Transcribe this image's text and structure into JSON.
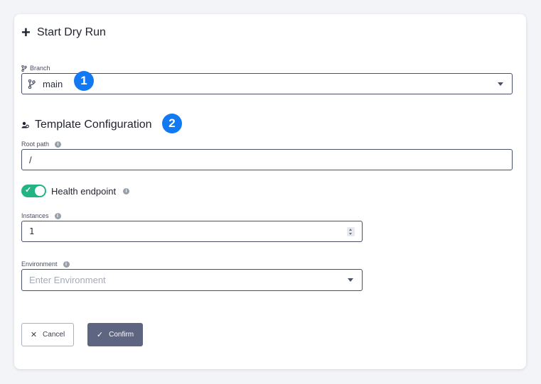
{
  "dialog": {
    "title": "Start Dry Run",
    "branch": {
      "label": "Branch",
      "value": "main"
    },
    "template_section": {
      "title": "Template Configuration",
      "root_path": {
        "label": "Root path",
        "value": "/"
      },
      "health_endpoint": {
        "label": "Health endpoint",
        "enabled": true
      },
      "instances": {
        "label": "Instances",
        "value": "1"
      },
      "environment": {
        "label": "Environment",
        "placeholder": "Enter Environment",
        "value": ""
      }
    },
    "buttons": {
      "cancel": "Cancel",
      "confirm": "Confirm"
    },
    "badges": [
      "1",
      "2"
    ]
  },
  "colors": {
    "badge": "#1379f2",
    "toggle_on": "#23b483",
    "confirm_button": "#5d6580",
    "background": "#f3f4f7"
  },
  "icons": {
    "title": "plus-icon",
    "branch": "git-branch-icon",
    "section": "people-group-icon",
    "info": "info-icon",
    "dropdown": "caret-down-icon",
    "cancel": "close-icon",
    "confirm": "check-icon"
  }
}
